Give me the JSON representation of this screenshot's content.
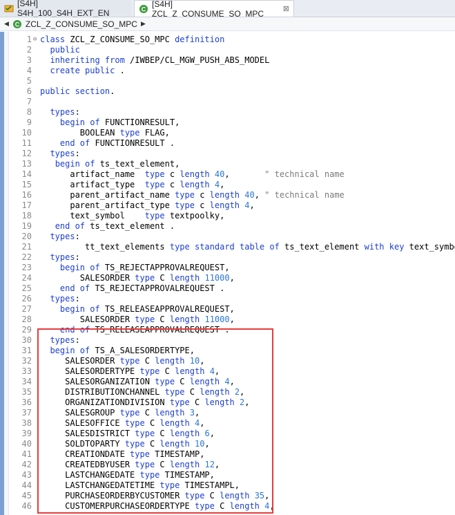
{
  "tabs": [
    {
      "label": "[S4H] S4H_100_S4H_EXT_EN",
      "icon": "abap-project-icon",
      "active": false
    },
    {
      "label": "[S4H] ZCL_Z_CONSUME_SO_MPC",
      "icon": "abap-class-icon",
      "active": true,
      "close": "⊠"
    }
  ],
  "breadcrumb": {
    "label": "ZCL_Z_CONSUME_SO_MPC"
  },
  "colors": {
    "keyword": "#1c3fd2",
    "number": "#2a77d6",
    "comment": "#7a7a7a",
    "highlight": "#e53b3b"
  },
  "code": [
    {
      "n": "1",
      "fold": "⊖",
      "tokens": [
        [
          "kw",
          "class"
        ],
        [
          "t",
          " ZCL_Z_CONSUME_SO_MPC "
        ],
        [
          "kw",
          "definition"
        ]
      ]
    },
    {
      "n": "2",
      "tokens": [
        [
          "t",
          "  "
        ],
        [
          "kw",
          "public"
        ]
      ]
    },
    {
      "n": "3",
      "tokens": [
        [
          "t",
          "  "
        ],
        [
          "kw",
          "inheriting from"
        ],
        [
          "t",
          " /IWBEP/CL_MGW_PUSH_ABS_MODEL"
        ]
      ]
    },
    {
      "n": "4",
      "tokens": [
        [
          "t",
          "  "
        ],
        [
          "kw",
          "create public"
        ],
        [
          "t",
          " ."
        ]
      ]
    },
    {
      "n": "5",
      "tokens": []
    },
    {
      "n": "6",
      "tokens": [
        [
          "kw",
          "public section"
        ],
        [
          "t",
          "."
        ]
      ]
    },
    {
      "n": "7",
      "tokens": []
    },
    {
      "n": "8",
      "tokens": [
        [
          "t",
          "  "
        ],
        [
          "kw",
          "types"
        ],
        [
          "t",
          ":"
        ]
      ]
    },
    {
      "n": "9",
      "tokens": [
        [
          "t",
          "    "
        ],
        [
          "kw",
          "begin of"
        ],
        [
          "t",
          " FUNCTIONRESULT,"
        ]
      ]
    },
    {
      "n": "10",
      "tokens": [
        [
          "t",
          "        BOOLEAN "
        ],
        [
          "kw",
          "type"
        ],
        [
          "t",
          " FLAG,"
        ]
      ]
    },
    {
      "n": "11",
      "tokens": [
        [
          "t",
          "    "
        ],
        [
          "kw",
          "end of"
        ],
        [
          "t",
          " FUNCTIONRESULT ."
        ]
      ]
    },
    {
      "n": "12",
      "tokens": [
        [
          "t",
          "  "
        ],
        [
          "kw",
          "types"
        ],
        [
          "t",
          ":"
        ]
      ]
    },
    {
      "n": "13",
      "tokens": [
        [
          "t",
          "   "
        ],
        [
          "kw",
          "begin of"
        ],
        [
          "t",
          " ts_text_element,"
        ]
      ]
    },
    {
      "n": "14",
      "tokens": [
        [
          "t",
          "      artifact_name  "
        ],
        [
          "kw",
          "type"
        ],
        [
          "t",
          " c "
        ],
        [
          "kw",
          "length"
        ],
        [
          "t",
          " "
        ],
        [
          "num",
          "40"
        ],
        [
          "t",
          ",       "
        ],
        [
          "com",
          "\" technical name"
        ]
      ]
    },
    {
      "n": "15",
      "tokens": [
        [
          "t",
          "      artifact_type  "
        ],
        [
          "kw",
          "type"
        ],
        [
          "t",
          " c "
        ],
        [
          "kw",
          "length"
        ],
        [
          "t",
          " "
        ],
        [
          "num",
          "4"
        ],
        [
          "t",
          ","
        ]
      ]
    },
    {
      "n": "16",
      "tokens": [
        [
          "t",
          "      parent_artifact_name "
        ],
        [
          "kw",
          "type"
        ],
        [
          "t",
          " c "
        ],
        [
          "kw",
          "length"
        ],
        [
          "t",
          " "
        ],
        [
          "num",
          "40"
        ],
        [
          "t",
          ", "
        ],
        [
          "com",
          "\" technical name"
        ]
      ]
    },
    {
      "n": "17",
      "tokens": [
        [
          "t",
          "      parent_artifact_type "
        ],
        [
          "kw",
          "type"
        ],
        [
          "t",
          " c "
        ],
        [
          "kw",
          "length"
        ],
        [
          "t",
          " "
        ],
        [
          "num",
          "4"
        ],
        [
          "t",
          ","
        ]
      ]
    },
    {
      "n": "18",
      "tokens": [
        [
          "t",
          "      text_symbol    "
        ],
        [
          "kw",
          "type"
        ],
        [
          "t",
          " textpoolky,"
        ]
      ]
    },
    {
      "n": "19",
      "tokens": [
        [
          "t",
          "   "
        ],
        [
          "kw",
          "end of"
        ],
        [
          "t",
          " ts_text_element ."
        ]
      ]
    },
    {
      "n": "20",
      "tokens": [
        [
          "t",
          "  "
        ],
        [
          "kw",
          "types"
        ],
        [
          "t",
          ":"
        ]
      ]
    },
    {
      "n": "21",
      "tokens": [
        [
          "t",
          "         tt_text_elements "
        ],
        [
          "kw",
          "type standard table of"
        ],
        [
          "t",
          " ts_text_element "
        ],
        [
          "kw",
          "with key"
        ],
        [
          "t",
          " text_symbol ."
        ]
      ]
    },
    {
      "n": "22",
      "tokens": [
        [
          "t",
          "  "
        ],
        [
          "kw",
          "types"
        ],
        [
          "t",
          ":"
        ]
      ]
    },
    {
      "n": "23",
      "tokens": [
        [
          "t",
          "    "
        ],
        [
          "kw",
          "begin of"
        ],
        [
          "t",
          " TS_REJECTAPPROVALREQUEST,"
        ]
      ]
    },
    {
      "n": "24",
      "tokens": [
        [
          "t",
          "        SALESORDER "
        ],
        [
          "kw",
          "type"
        ],
        [
          "t",
          " C "
        ],
        [
          "kw",
          "length"
        ],
        [
          "t",
          " "
        ],
        [
          "num",
          "11000"
        ],
        [
          "t",
          ","
        ]
      ]
    },
    {
      "n": "25",
      "tokens": [
        [
          "t",
          "    "
        ],
        [
          "kw",
          "end of"
        ],
        [
          "t",
          " TS_REJECTAPPROVALREQUEST ."
        ]
      ]
    },
    {
      "n": "26",
      "tokens": [
        [
          "t",
          "  "
        ],
        [
          "kw",
          "types"
        ],
        [
          "t",
          ":"
        ]
      ]
    },
    {
      "n": "27",
      "tokens": [
        [
          "t",
          "    "
        ],
        [
          "kw",
          "begin of"
        ],
        [
          "t",
          " TS_RELEASEAPPROVALREQUEST,"
        ]
      ]
    },
    {
      "n": "28",
      "tokens": [
        [
          "t",
          "        SALESORDER "
        ],
        [
          "kw",
          "type"
        ],
        [
          "t",
          " C "
        ],
        [
          "kw",
          "length"
        ],
        [
          "t",
          " "
        ],
        [
          "num",
          "11000"
        ],
        [
          "t",
          ","
        ]
      ]
    },
    {
      "n": "29",
      "tokens": [
        [
          "t",
          "    "
        ],
        [
          "kw",
          "end of"
        ],
        [
          "t",
          " TS_RELEASEAPPROVALREQUEST ."
        ]
      ]
    },
    {
      "n": "30",
      "tokens": [
        [
          "t",
          "  "
        ],
        [
          "kw",
          "types"
        ],
        [
          "t",
          ":"
        ]
      ]
    },
    {
      "n": "31",
      "tokens": [
        [
          "t",
          "  "
        ],
        [
          "kw",
          "begin of"
        ],
        [
          "t",
          " TS_A_SALESORDERTYPE,"
        ]
      ]
    },
    {
      "n": "32",
      "tokens": [
        [
          "t",
          "     SALESORDER "
        ],
        [
          "kw",
          "type"
        ],
        [
          "t",
          " C "
        ],
        [
          "kw",
          "length"
        ],
        [
          "t",
          " "
        ],
        [
          "num",
          "10"
        ],
        [
          "t",
          ","
        ]
      ]
    },
    {
      "n": "33",
      "tokens": [
        [
          "t",
          "     SALESORDERTYPE "
        ],
        [
          "kw",
          "type"
        ],
        [
          "t",
          " C "
        ],
        [
          "kw",
          "length"
        ],
        [
          "t",
          " "
        ],
        [
          "num",
          "4"
        ],
        [
          "t",
          ","
        ]
      ]
    },
    {
      "n": "34",
      "tokens": [
        [
          "t",
          "     SALESORGANIZATION "
        ],
        [
          "kw",
          "type"
        ],
        [
          "t",
          " C "
        ],
        [
          "kw",
          "length"
        ],
        [
          "t",
          " "
        ],
        [
          "num",
          "4"
        ],
        [
          "t",
          ","
        ]
      ]
    },
    {
      "n": "35",
      "tokens": [
        [
          "t",
          "     DISTRIBUTIONCHANNEL "
        ],
        [
          "kw",
          "type"
        ],
        [
          "t",
          " C "
        ],
        [
          "kw",
          "length"
        ],
        [
          "t",
          " "
        ],
        [
          "num",
          "2"
        ],
        [
          "t",
          ","
        ]
      ]
    },
    {
      "n": "36",
      "tokens": [
        [
          "t",
          "     ORGANIZATIONDIVISION "
        ],
        [
          "kw",
          "type"
        ],
        [
          "t",
          " C "
        ],
        [
          "kw",
          "length"
        ],
        [
          "t",
          " "
        ],
        [
          "num",
          "2"
        ],
        [
          "t",
          ","
        ]
      ]
    },
    {
      "n": "37",
      "tokens": [
        [
          "t",
          "     SALESGROUP "
        ],
        [
          "kw",
          "type"
        ],
        [
          "t",
          " C "
        ],
        [
          "kw",
          "length"
        ],
        [
          "t",
          " "
        ],
        [
          "num",
          "3"
        ],
        [
          "t",
          ","
        ]
      ]
    },
    {
      "n": "38",
      "tokens": [
        [
          "t",
          "     SALESOFFICE "
        ],
        [
          "kw",
          "type"
        ],
        [
          "t",
          " C "
        ],
        [
          "kw",
          "length"
        ],
        [
          "t",
          " "
        ],
        [
          "num",
          "4"
        ],
        [
          "t",
          ","
        ]
      ]
    },
    {
      "n": "39",
      "tokens": [
        [
          "t",
          "     SALESDISTRICT "
        ],
        [
          "kw",
          "type"
        ],
        [
          "t",
          " C "
        ],
        [
          "kw",
          "length"
        ],
        [
          "t",
          " "
        ],
        [
          "num",
          "6"
        ],
        [
          "t",
          ","
        ]
      ]
    },
    {
      "n": "40",
      "tokens": [
        [
          "t",
          "     SOLDTOPARTY "
        ],
        [
          "kw",
          "type"
        ],
        [
          "t",
          " C "
        ],
        [
          "kw",
          "length"
        ],
        [
          "t",
          " "
        ],
        [
          "num",
          "10"
        ],
        [
          "t",
          ","
        ]
      ]
    },
    {
      "n": "41",
      "tokens": [
        [
          "t",
          "     CREATIONDATE "
        ],
        [
          "kw",
          "type"
        ],
        [
          "t",
          " TIMESTAMP,"
        ]
      ]
    },
    {
      "n": "42",
      "tokens": [
        [
          "t",
          "     CREATEDBYUSER "
        ],
        [
          "kw",
          "type"
        ],
        [
          "t",
          " C "
        ],
        [
          "kw",
          "length"
        ],
        [
          "t",
          " "
        ],
        [
          "num",
          "12"
        ],
        [
          "t",
          ","
        ]
      ]
    },
    {
      "n": "43",
      "tokens": [
        [
          "t",
          "     LASTCHANGEDATE "
        ],
        [
          "kw",
          "type"
        ],
        [
          "t",
          " TIMESTAMP,"
        ]
      ]
    },
    {
      "n": "44",
      "tokens": [
        [
          "t",
          "     LASTCHANGEDATETIME "
        ],
        [
          "kw",
          "type"
        ],
        [
          "t",
          " TIMESTAMPL,"
        ]
      ]
    },
    {
      "n": "45",
      "tokens": [
        [
          "t",
          "     PURCHASEORDERBYCUSTOMER "
        ],
        [
          "kw",
          "type"
        ],
        [
          "t",
          " C "
        ],
        [
          "kw",
          "length"
        ],
        [
          "t",
          " "
        ],
        [
          "num",
          "35"
        ],
        [
          "t",
          ","
        ]
      ]
    },
    {
      "n": "46",
      "tokens": [
        [
          "t",
          "     CUSTOMERPURCHASEORDERTYPE "
        ],
        [
          "kw",
          "type"
        ],
        [
          "t",
          " C "
        ],
        [
          "kw",
          "length"
        ],
        [
          "t",
          " "
        ],
        [
          "num",
          "4"
        ],
        [
          "t",
          ","
        ]
      ]
    }
  ]
}
